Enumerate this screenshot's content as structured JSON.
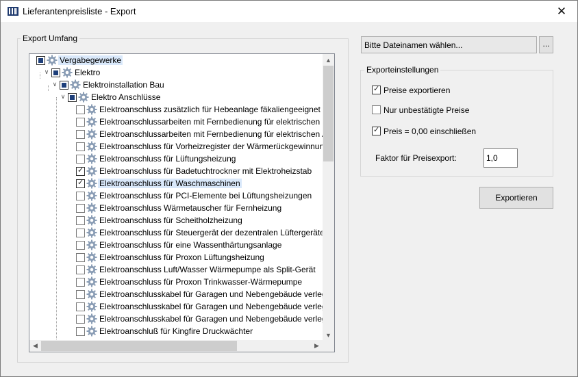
{
  "window": {
    "title": "Lieferantenpreisliste - Export",
    "close_glyph": "✕"
  },
  "left_group": {
    "label": "Export Umfang"
  },
  "tree": {
    "root": "Vergabegewerke",
    "level1": "Elektro",
    "level2": "Elektroinstallation Bau",
    "level3": "Elektro Anschlüsse",
    "items": [
      {
        "label": "Elektroanschluss zusätzlich für Hebeanlage fäkaliengeeignet",
        "checked": false
      },
      {
        "label": "Elektroanschlussarbeiten mit Fernbedienung für elektrischen Ro",
        "checked": false
      },
      {
        "label": "Elektroanschlussarbeiten mit Fernbedienung für elektrischen Au",
        "checked": false
      },
      {
        "label": "Elektroanschluss für Vorheizregister der Wärmerückgewinnungs",
        "checked": false
      },
      {
        "label": "Elektroanschluss für Lüftungsheizung",
        "checked": false
      },
      {
        "label": "Elektroanschluss für Badetuchtrockner mit Elektroheizstab",
        "checked": true
      },
      {
        "label": "Elektroanschluss für Waschmaschinen",
        "checked": true
      },
      {
        "label": "Elektroanschluss für PCI-Elemente bei Lüftungsheizungen",
        "checked": false
      },
      {
        "label": "Elektroanschluss Wärmetauscher für Fernheizung",
        "checked": false
      },
      {
        "label": "Elektroanschluss für Scheitholzheizung",
        "checked": false
      },
      {
        "label": "Elektroanschluss für Steuergerät der dezentralen Lüftergeräte",
        "checked": false
      },
      {
        "label": "Elektroanschluss für eine Wassenthärtungsanlage",
        "checked": false
      },
      {
        "label": "Elektroanschluss für Proxon Lüftungsheizung",
        "checked": false
      },
      {
        "label": "Elektroanschluss Luft/Wasser Wärmepumpe als Split-Gerät",
        "checked": false
      },
      {
        "label": "Elektroanschluss für Proxon Trinkwasser-Wärmepumpe",
        "checked": false
      },
      {
        "label": "Elektroanschlusskabel für Garagen und Nebengebäude verleger",
        "checked": false
      },
      {
        "label": "Elektroanschlusskabel für Garagen und Nebengebäude verleger",
        "checked": false
      },
      {
        "label": "Elektroanschlusskabel für Garagen und Nebengebäude verleger",
        "checked": false
      },
      {
        "label": "Elektroanschluß für Kingfire Druckwächter",
        "checked": false
      }
    ]
  },
  "file": {
    "placeholder": "Bitte Dateinamen wählen...",
    "browse_label": "..."
  },
  "settings": {
    "label": "Exporteinstellungen",
    "export_prices": {
      "label": "Preise exportieren",
      "checked": true
    },
    "unconfirmed_only": {
      "label": "Nur unbestätigte Preise",
      "checked": false
    },
    "include_zero": {
      "label": "Preis = 0,00 einschließen",
      "checked": true
    },
    "factor_label": "Faktor für Preisexport:",
    "factor_value": "1,0"
  },
  "export_button": "Exportieren"
}
